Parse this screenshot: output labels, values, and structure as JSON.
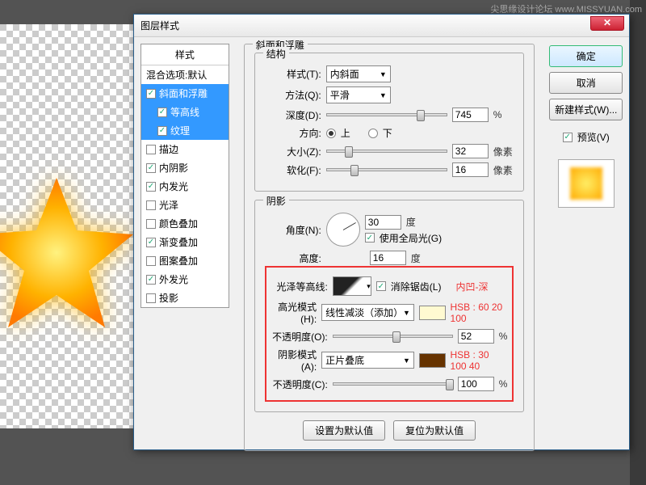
{
  "watermark": "尖思缘设计论坛 www.MISSYUAN.com",
  "dialog": {
    "title": "图层样式",
    "styles_header": "样式",
    "blend_options": "混合选项:默认",
    "items": [
      {
        "label": "斜面和浮雕",
        "checked": true,
        "selected": true
      },
      {
        "label": "等高线",
        "checked": true,
        "sub": true,
        "selected": true
      },
      {
        "label": "纹理",
        "checked": true,
        "sub": true,
        "selected": true
      },
      {
        "label": "描边",
        "checked": false
      },
      {
        "label": "内阴影",
        "checked": true
      },
      {
        "label": "内发光",
        "checked": true
      },
      {
        "label": "光泽",
        "checked": false
      },
      {
        "label": "颜色叠加",
        "checked": false
      },
      {
        "label": "渐变叠加",
        "checked": true
      },
      {
        "label": "图案叠加",
        "checked": false
      },
      {
        "label": "外发光",
        "checked": true
      },
      {
        "label": "投影",
        "checked": false
      }
    ],
    "panel_title": "斜面和浮雕",
    "structure": {
      "group": "结构",
      "style_lbl": "样式(T):",
      "style_val": "内斜面",
      "method_lbl": "方法(Q):",
      "method_val": "平滑",
      "depth_lbl": "深度(D):",
      "depth_val": "745",
      "depth_unit": "%",
      "direction_lbl": "方向:",
      "dir_up": "上",
      "dir_down": "下",
      "size_lbl": "大小(Z):",
      "size_val": "32",
      "size_unit": "像素",
      "soften_lbl": "软化(F):",
      "soften_val": "16",
      "soften_unit": "像素"
    },
    "shading": {
      "group": "阴影",
      "angle_lbl": "角度(N):",
      "angle_val": "30",
      "angle_unit": "度",
      "global_lbl": "使用全局光(G)",
      "altitude_lbl": "高度:",
      "altitude_val": "16",
      "altitude_unit": "度",
      "contour_lbl": "光泽等高线:",
      "antialias_lbl": "消除锯齿(L)",
      "annotation1": "内凹-深",
      "hmode_lbl": "高光模式(H):",
      "hmode_val": "线性减淡（添加）",
      "annotation2": "HSB : 60 20 100",
      "hopacity_lbl": "不透明度(O):",
      "hopacity_val": "52",
      "hopacity_unit": "%",
      "smode_lbl": "阴影模式(A):",
      "smode_val": "正片叠底",
      "annotation3": "HSB : 30 100 40",
      "sopacity_lbl": "不透明度(C):",
      "sopacity_val": "100",
      "sopacity_unit": "%"
    },
    "buttons": {
      "default": "设置为默认值",
      "reset": "复位为默认值"
    },
    "right": {
      "ok": "确定",
      "cancel": "取消",
      "newstyle": "新建样式(W)...",
      "preview_lbl": "预览(V)"
    }
  }
}
